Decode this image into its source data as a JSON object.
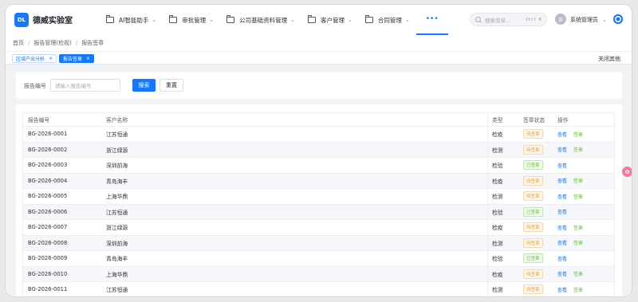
{
  "app": {
    "logo_text": "DL",
    "brand": "德威实验室"
  },
  "nav": [
    {
      "label": "AI智能助手"
    },
    {
      "label": "审批管理"
    },
    {
      "label": "公司基础资料管理"
    },
    {
      "label": "客户管理"
    },
    {
      "label": "合同管理"
    }
  ],
  "nav_more": "•••",
  "search": {
    "placeholder": "搜索菜单...",
    "shortcut": "Ctrl K"
  },
  "user": {
    "avatar_text": "系",
    "name": "系统管理员"
  },
  "breadcrumb": [
    "首页",
    "报告管理(检视)",
    "报告签章"
  ],
  "tabs": [
    {
      "label": "区域产出分析",
      "active": false
    },
    {
      "label": "报告签章",
      "active": true
    }
  ],
  "close_others": "关闭其他",
  "filter": {
    "label": "报告编号",
    "placeholder": "请输入报告编号",
    "search_btn": "搜索",
    "reset_btn": "重置"
  },
  "table": {
    "headers": [
      "报告编号",
      "客户名称",
      "类型",
      "签章状态",
      "操作"
    ],
    "rows": [
      {
        "no": "BG-2026-0001",
        "customer": "江苏恒通",
        "type": "检疫",
        "status": "待签章",
        "ops": [
          "查看",
          "签章"
        ]
      },
      {
        "no": "BG-2026-0002",
        "customer": "浙江绿源",
        "type": "检测",
        "status": "待签章",
        "ops": [
          "查看",
          "签章"
        ]
      },
      {
        "no": "BG-2026-0003",
        "customer": "深圳前海",
        "type": "检验",
        "status": "已签章",
        "ops": [
          "查看"
        ]
      },
      {
        "no": "BG-2026-0004",
        "customer": "青岛海丰",
        "type": "检疫",
        "status": "待签章",
        "ops": [
          "查看",
          "签章"
        ]
      },
      {
        "no": "BG-2026-0005",
        "customer": "上海华鼎",
        "type": "检测",
        "status": "待签章",
        "ops": [
          "查看",
          "签章"
        ]
      },
      {
        "no": "BG-2026-0006",
        "customer": "江苏恒通",
        "type": "检验",
        "status": "已签章",
        "ops": [
          "查看"
        ]
      },
      {
        "no": "BG-2026-0007",
        "customer": "浙江绿源",
        "type": "检疫",
        "status": "待签章",
        "ops": [
          "查看",
          "签章"
        ]
      },
      {
        "no": "BG-2026-0008",
        "customer": "深圳前海",
        "type": "检测",
        "status": "待签章",
        "ops": [
          "查看",
          "签章"
        ]
      },
      {
        "no": "BG-2026-0009",
        "customer": "青岛海丰",
        "type": "检验",
        "status": "已签章",
        "ops": [
          "查看"
        ]
      },
      {
        "no": "BG-2026-0010",
        "customer": "上海华鼎",
        "type": "检疫",
        "status": "待签章",
        "ops": [
          "查看",
          "签章"
        ]
      },
      {
        "no": "BG-2026-0011",
        "customer": "江苏恒通",
        "type": "检测",
        "status": "待签章",
        "ops": [
          "查看",
          "签章"
        ]
      }
    ]
  },
  "colors": {
    "accent": "#1677ff",
    "pending": "#e6a23c",
    "signed": "#67c23a",
    "float_widget": "#ee7d9c"
  }
}
